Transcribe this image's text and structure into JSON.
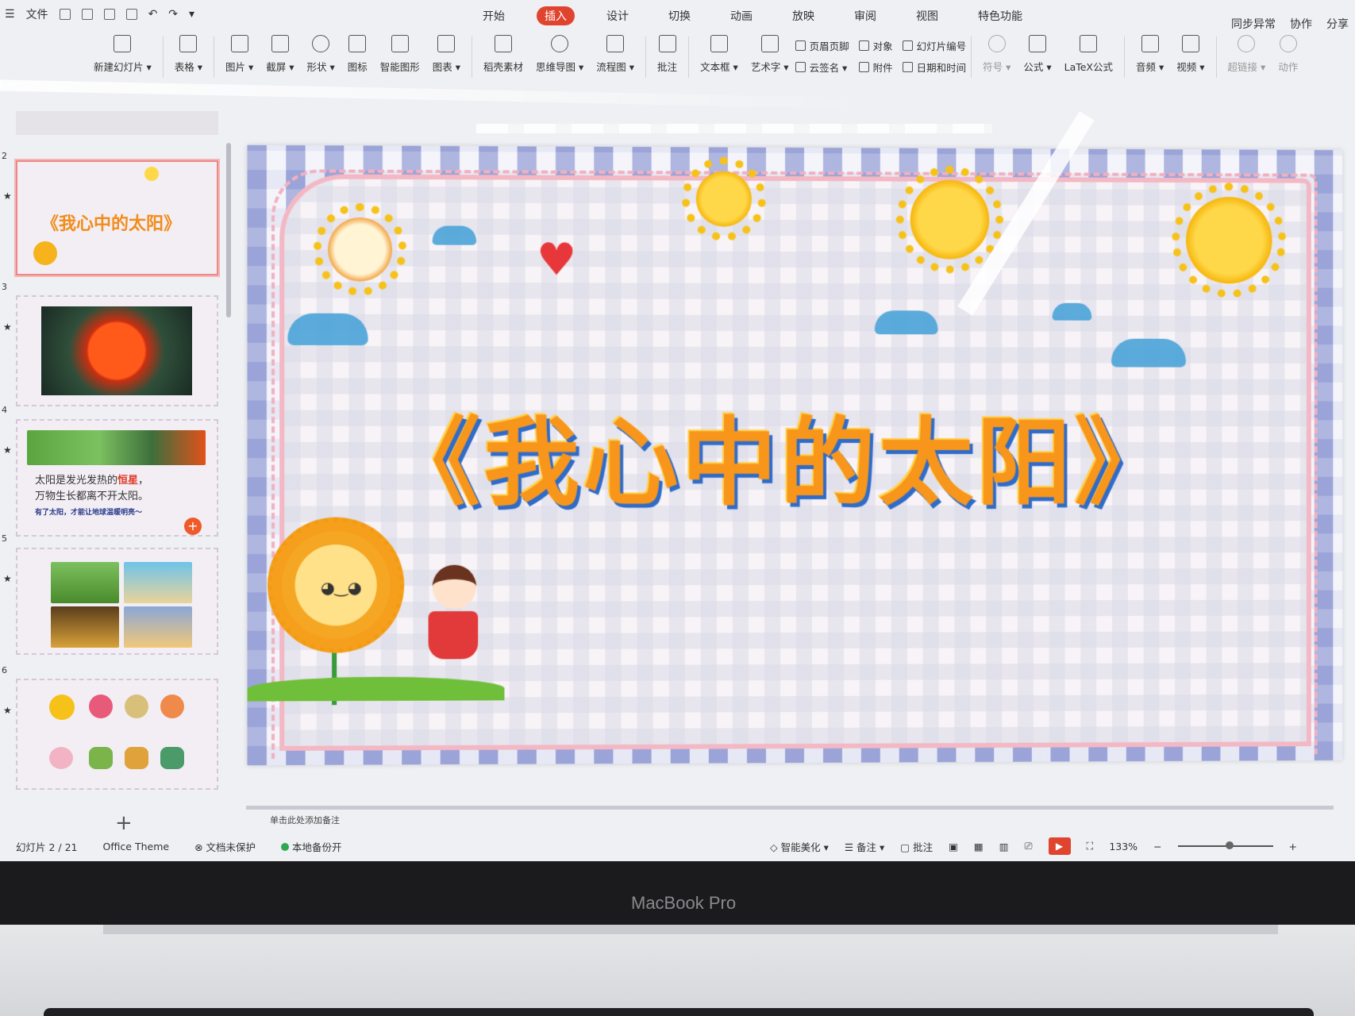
{
  "menu": {
    "file": "文件",
    "tabs": [
      "开始",
      "插入",
      "设计",
      "切换",
      "动画",
      "放映",
      "审阅",
      "视图",
      "特色功能"
    ],
    "active_tab": "插入",
    "right": [
      "同步异常",
      "协作",
      "分享"
    ]
  },
  "ribbon": {
    "groups": [
      {
        "label": "新建幻灯片 ▾"
      },
      {
        "label": "表格 ▾"
      },
      {
        "label": "图片 ▾"
      },
      {
        "label": "截屏 ▾"
      },
      {
        "label": "形状 ▾"
      },
      {
        "label": "图标"
      },
      {
        "label": "智能图形"
      },
      {
        "label": "图表 ▾"
      },
      {
        "label": "稻壳素材"
      },
      {
        "label": "思维导图 ▾"
      },
      {
        "label": "流程图 ▾"
      },
      {
        "label": "批注"
      },
      {
        "label": "文本框 ▾"
      },
      {
        "label": "艺术字 ▾"
      }
    ],
    "small_col1": [
      "页眉页脚",
      "云签名 ▾"
    ],
    "small_col2": [
      "对象",
      "附件"
    ],
    "small_col3": [
      "幻灯片编号",
      "日期和时间"
    ],
    "groups2": [
      {
        "label": "符号 ▾"
      },
      {
        "label": "公式 ▾"
      },
      {
        "label": "LaTeX公式"
      },
      {
        "label": "音频 ▾"
      },
      {
        "label": "视频 ▾"
      },
      {
        "label": "超链接 ▾"
      },
      {
        "label": "动作"
      }
    ]
  },
  "thumbnails": {
    "numbers": [
      "2",
      "3",
      "4",
      "5",
      "6"
    ],
    "slide2_title": "《我心中的太阳》",
    "slide4_line1_pre": "太阳是发光发热的",
    "slide4_line1_em": "恒星",
    "slide4_line1_post": "，",
    "slide4_line2": "万物生长都离不开太阳。",
    "slide4_small": "有了太阳，才能让地球温暖明亮～",
    "add": "+"
  },
  "slide": {
    "title": "《我心中的太阳》"
  },
  "notes_placeholder": "单击此处添加备注",
  "status": {
    "slide_counter": "幻灯片 2 / 21",
    "theme": "Office Theme",
    "protect": "文档未保护",
    "backup": "本地备份开",
    "beautify": "智能美化 ▾",
    "notes": "备注 ▾",
    "comments": "批注",
    "zoom": "133%"
  },
  "laptop_brand": "MacBook Pro",
  "colors": {
    "accent": "#e0442f",
    "title_orange": "#f7961b",
    "title_shadow": "#2f6bc9"
  }
}
